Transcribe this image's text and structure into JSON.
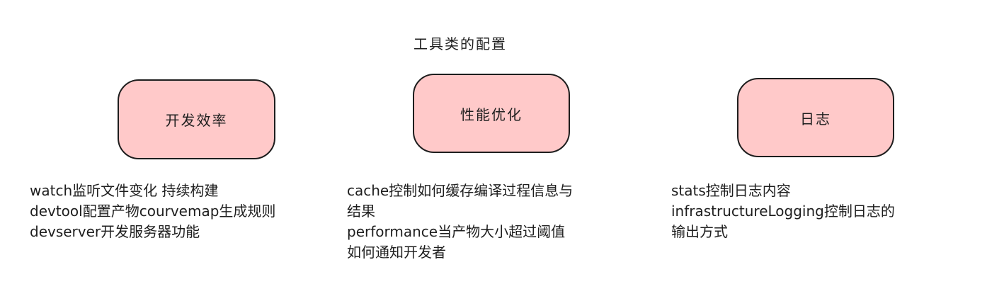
{
  "diagram": {
    "title": "工具类的配置",
    "nodes": [
      {
        "label": "开发效率"
      },
      {
        "label": "性能优化"
      },
      {
        "label": "日志"
      }
    ],
    "notes": [
      {
        "lines": [
          "watch监听文件变化 持续构建",
          "devtool配置产物courvemap生成规则",
          "devserver开发服务器功能"
        ]
      },
      {
        "lines": [
          "cache控制如何缓存编译过程信息与",
          "结果",
          "performance当产物大小超过阈值",
          "如何通知开发者"
        ]
      },
      {
        "lines": [
          "stats控制日志内容",
          "infrastructureLogging控制日志的",
          "输出方式"
        ]
      }
    ],
    "colors": {
      "node_fill": "#ffc9c9",
      "stroke": "#1e1e1e"
    }
  }
}
